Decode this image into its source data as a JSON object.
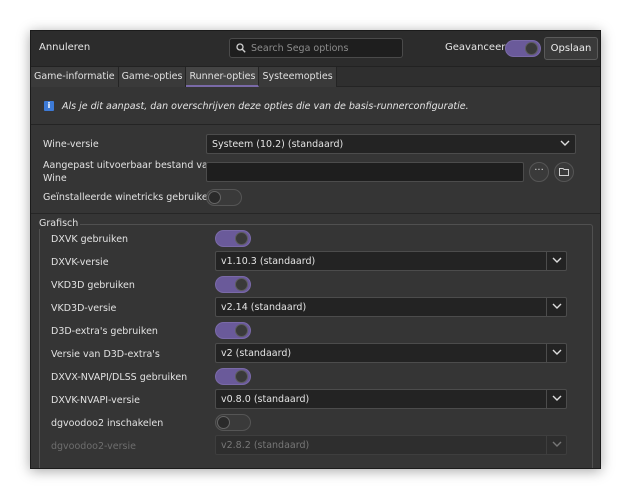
{
  "header": {
    "cancel_label": "Annuleren",
    "search_placeholder": "Search Sega options",
    "advanced_label": "Geavanceerd",
    "advanced_on": true,
    "save_label": "Opslaan"
  },
  "tabs": [
    {
      "label": "Game-informatie",
      "active": false
    },
    {
      "label": "Game-opties",
      "active": false
    },
    {
      "label": "Runner-opties",
      "active": true
    },
    {
      "label": "Systeemopties",
      "active": false
    }
  ],
  "info": {
    "text": "Als je dit aanpast, dan overschrijven deze opties die van de basis-runnerconfiguratie."
  },
  "wine": {
    "version_label": "Wine-versie",
    "version_value": "Systeem (10.2) (standaard)",
    "custom_exe_label_line1": "Aangepast uitvoerbaar bestand van",
    "custom_exe_label_line2": "Wine",
    "custom_exe_value": "",
    "more_label": "···",
    "winetricks_label": "Geïnstalleerde winetricks gebruiken",
    "winetricks_on": false
  },
  "graphics": {
    "title": "Grafisch",
    "dxvk_label": "DXVK gebruiken",
    "dxvk_on": true,
    "dxvk_version_label": "DXVK-versie",
    "dxvk_version_value": "v1.10.3 (standaard)",
    "vkd3d_label": "VKD3D gebruiken",
    "vkd3d_on": true,
    "vkd3d_version_label": "VKD3D-versie",
    "vkd3d_version_value": "v2.14 (standaard)",
    "d3d_extras_label": "D3D-extra's gebruiken",
    "d3d_extras_on": true,
    "d3d_extras_version_label": "Versie van D3D-extra's",
    "d3d_extras_version_value": "v2 (standaard)",
    "nvapi_label": "DXVX-NVAPI/DLSS gebruiken",
    "nvapi_on": true,
    "nvapi_version_label": "DXVK-NVAPI-versie",
    "nvapi_version_value": "v0.8.0 (standaard)",
    "dgvoodoo_label": "dgvoodoo2 inschakelen",
    "dgvoodoo_on": false,
    "dgvoodoo_version_label": "dgvoodoo2-versie",
    "dgvoodoo_version_value": "v2.8.2 (standaard)"
  },
  "colors": {
    "accent": "#6a5a9a",
    "info_icon": "#3d7ad6",
    "window_bg": "#353535"
  }
}
